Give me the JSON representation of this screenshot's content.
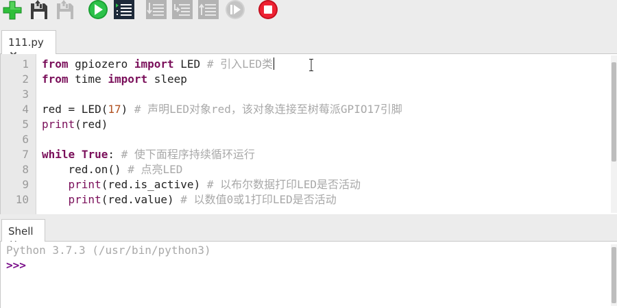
{
  "toolbar": {
    "buttons": [
      {
        "name": "new-file",
        "icon": "plus-icon",
        "color": "#22b14c",
        "enabled": true
      },
      {
        "name": "load",
        "icon": "floppy-icon",
        "enabled": true
      },
      {
        "name": "save",
        "icon": "floppy-icon",
        "enabled": false
      },
      {
        "name": "run",
        "icon": "play-icon",
        "color": "#22b14c",
        "enabled": true
      },
      {
        "name": "debug",
        "icon": "debug-icon",
        "enabled": true
      },
      {
        "name": "step-over",
        "icon": "step-over-icon",
        "enabled": false
      },
      {
        "name": "step-into",
        "icon": "step-into-icon",
        "enabled": false
      },
      {
        "name": "step-out",
        "icon": "step-out-icon",
        "enabled": false
      },
      {
        "name": "resume",
        "icon": "resume-icon",
        "enabled": false
      },
      {
        "name": "stop",
        "icon": "stop-icon",
        "color": "#e21a2a",
        "enabled": true
      }
    ]
  },
  "editor": {
    "tab_label": "111.py",
    "line_numbers": [
      "1",
      "2",
      "3",
      "4",
      "5",
      "6",
      "7",
      "8",
      "9",
      "10"
    ],
    "lines": [
      {
        "tokens": [
          {
            "t": "kw",
            "v": "from"
          },
          {
            "t": "pl",
            "v": " gpiozero "
          },
          {
            "t": "kw",
            "v": "import"
          },
          {
            "t": "pl",
            "v": " LED "
          },
          {
            "t": "cm",
            "v": "# 引入LED类"
          }
        ],
        "cursor": true
      },
      {
        "tokens": [
          {
            "t": "kw",
            "v": "from"
          },
          {
            "t": "pl",
            "v": " time "
          },
          {
            "t": "kw",
            "v": "import"
          },
          {
            "t": "pl",
            "v": " sleep"
          }
        ]
      },
      {
        "tokens": []
      },
      {
        "tokens": [
          {
            "t": "pl",
            "v": "red = LED("
          },
          {
            "t": "num",
            "v": "17"
          },
          {
            "t": "pl",
            "v": ") "
          },
          {
            "t": "cm",
            "v": "# 声明LED对象red，该对象连接至树莓派GPIO17引脚"
          }
        ]
      },
      {
        "tokens": [
          {
            "t": "bi",
            "v": "print"
          },
          {
            "t": "pl",
            "v": "(red)"
          }
        ]
      },
      {
        "tokens": []
      },
      {
        "tokens": [
          {
            "t": "kw",
            "v": "while"
          },
          {
            "t": "pl",
            "v": " "
          },
          {
            "t": "kw",
            "v": "True"
          },
          {
            "t": "pl",
            "v": ": "
          },
          {
            "t": "cm",
            "v": "# 使下面程序持续循环运行"
          }
        ]
      },
      {
        "tokens": [
          {
            "t": "pl",
            "v": "    red.on() "
          },
          {
            "t": "cm",
            "v": "# 点亮LED"
          }
        ]
      },
      {
        "tokens": [
          {
            "t": "pl",
            "v": "    "
          },
          {
            "t": "bi",
            "v": "print"
          },
          {
            "t": "pl",
            "v": "(red.is_active) "
          },
          {
            "t": "cm",
            "v": "# 以布尔数据打印LED是否活动"
          }
        ]
      },
      {
        "tokens": [
          {
            "t": "pl",
            "v": "    "
          },
          {
            "t": "bi",
            "v": "print"
          },
          {
            "t": "pl",
            "v": "(red.value) "
          },
          {
            "t": "cm",
            "v": "# 以数值0或1打印LED是否活动"
          }
        ]
      }
    ]
  },
  "shell": {
    "tab_label": "Shell",
    "banner": "Python 3.7.3 (/usr/bin/python3)",
    "prompt": ">>>"
  },
  "colors": {
    "keyword": "#7a0f5a",
    "number": "#b0501f",
    "comment": "#a8a8a8",
    "prompt": "#7a0f8a"
  }
}
